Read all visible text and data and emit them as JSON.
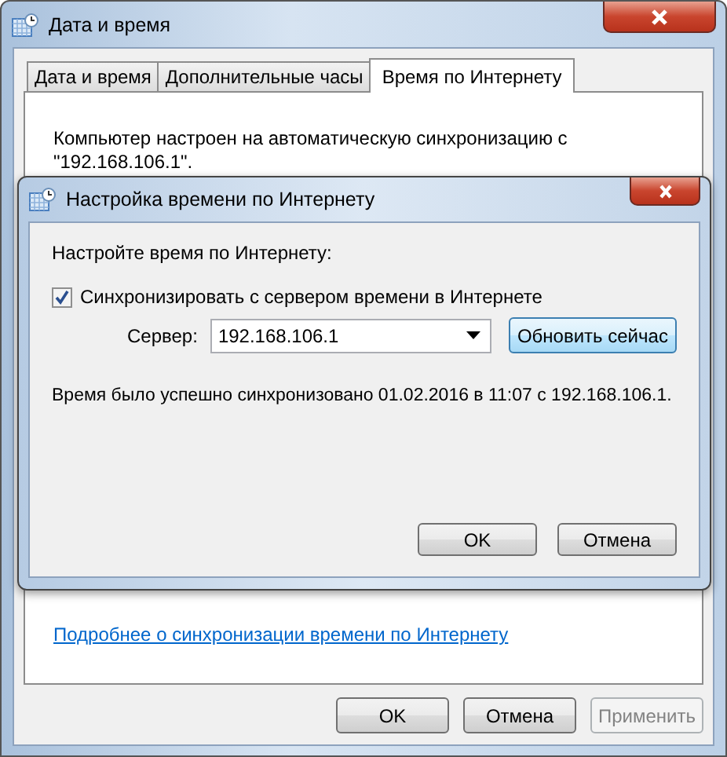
{
  "window": {
    "title": "Дата и время"
  },
  "tabs": [
    {
      "label": "Дата и время",
      "selected": false
    },
    {
      "label": "Дополнительные часы",
      "selected": false
    },
    {
      "label": "Время по Интернету",
      "selected": true
    }
  ],
  "description": "Компьютер настроен на автоматическую синхронизацию с \"192.168.106.1\".",
  "link": "Подробнее о синхронизации времени по Интернету",
  "buttons": [
    {
      "label": "OK",
      "disabled": false
    },
    {
      "label": "Отмена",
      "disabled": false
    },
    {
      "label": "Применить",
      "disabled": true
    }
  ],
  "dialog": {
    "title": "Настройка времени по Интернету",
    "heading": "Настройте время по Интернету:",
    "sync": {
      "label": "Синхронизировать с сервером времени в Интернете",
      "checked": true
    },
    "server_label": "Сервер:",
    "server_value": "192.168.106.1",
    "update_button": "Обновить сейчас",
    "status": "Время было успешно синхронизовано 01.02.2016 в 11:07 с 192.168.106.1.",
    "buttons": [
      {
        "label": "OK",
        "disabled": false
      },
      {
        "label": "Отмена",
        "disabled": false
      }
    ]
  }
}
